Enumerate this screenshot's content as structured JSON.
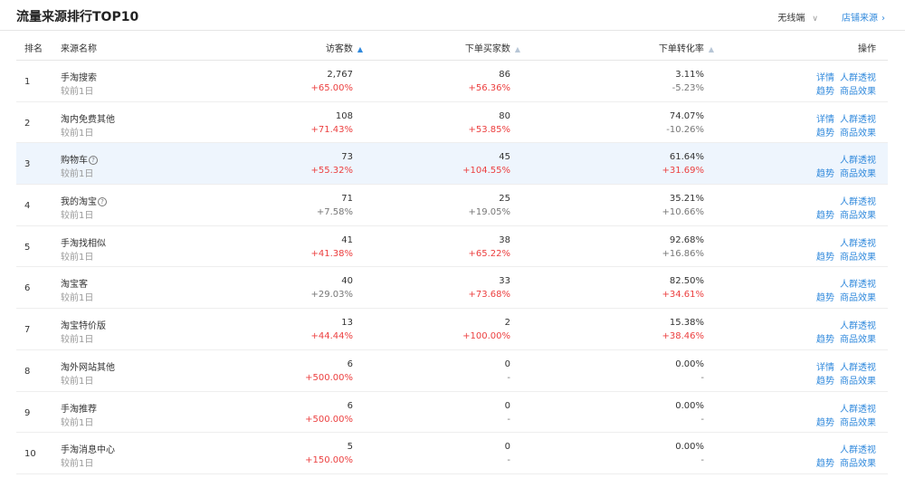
{
  "header": {
    "title": "流量来源排行TOP10",
    "device": "无线端",
    "device_chevron": "∨",
    "source_link": "店铺来源",
    "source_chevron": "›"
  },
  "columns": {
    "rank": "排名",
    "source": "来源名称",
    "visitors": "访客数",
    "buyers": "下单买家数",
    "conversion": "下单转化率",
    "actions": "操作"
  },
  "actions": {
    "detail": "详情",
    "crowd": "人群透视",
    "trend": "趋势",
    "product": "商品效果"
  },
  "rows": [
    {
      "rank": "1",
      "name": "手淘搜索",
      "help": false,
      "sub": "较前1日",
      "visitors": "2,767",
      "visitors_chg": "+65.00%",
      "visitors_up": true,
      "buyers": "86",
      "buyers_chg": "+56.36%",
      "buyers_up": true,
      "conv": "3.11%",
      "conv_chg": "-5.23%",
      "conv_up": false,
      "detail": true,
      "highlight": false
    },
    {
      "rank": "2",
      "name": "淘内免费其他",
      "help": false,
      "sub": "较前1日",
      "visitors": "108",
      "visitors_chg": "+71.43%",
      "visitors_up": true,
      "buyers": "80",
      "buyers_chg": "+53.85%",
      "buyers_up": true,
      "conv": "74.07%",
      "conv_chg": "-10.26%",
      "conv_up": false,
      "detail": true,
      "highlight": false
    },
    {
      "rank": "3",
      "name": "购物车",
      "help": true,
      "sub": "较前1日",
      "visitors": "73",
      "visitors_chg": "+55.32%",
      "visitors_up": true,
      "buyers": "45",
      "buyers_chg": "+104.55%",
      "buyers_up": true,
      "conv": "61.64%",
      "conv_chg": "+31.69%",
      "conv_up": true,
      "detail": false,
      "highlight": true
    },
    {
      "rank": "4",
      "name": "我的淘宝",
      "help": true,
      "sub": "较前1日",
      "visitors": "71",
      "visitors_chg": "+7.58%",
      "visitors_up": false,
      "buyers": "25",
      "buyers_chg": "+19.05%",
      "buyers_up": false,
      "conv": "35.21%",
      "conv_chg": "+10.66%",
      "conv_up": false,
      "detail": false,
      "highlight": false
    },
    {
      "rank": "5",
      "name": "手淘找相似",
      "help": false,
      "sub": "较前1日",
      "visitors": "41",
      "visitors_chg": "+41.38%",
      "visitors_up": true,
      "buyers": "38",
      "buyers_chg": "+65.22%",
      "buyers_up": true,
      "conv": "92.68%",
      "conv_chg": "+16.86%",
      "conv_up": false,
      "detail": false,
      "highlight": false
    },
    {
      "rank": "6",
      "name": "淘宝客",
      "help": false,
      "sub": "较前1日",
      "visitors": "40",
      "visitors_chg": "+29.03%",
      "visitors_up": false,
      "buyers": "33",
      "buyers_chg": "+73.68%",
      "buyers_up": true,
      "conv": "82.50%",
      "conv_chg": "+34.61%",
      "conv_up": true,
      "detail": false,
      "highlight": false
    },
    {
      "rank": "7",
      "name": "淘宝特价版",
      "help": false,
      "sub": "较前1日",
      "visitors": "13",
      "visitors_chg": "+44.44%",
      "visitors_up": true,
      "buyers": "2",
      "buyers_chg": "+100.00%",
      "buyers_up": true,
      "conv": "15.38%",
      "conv_chg": "+38.46%",
      "conv_up": true,
      "detail": false,
      "highlight": false
    },
    {
      "rank": "8",
      "name": "淘外网站其他",
      "help": false,
      "sub": "较前1日",
      "visitors": "6",
      "visitors_chg": "+500.00%",
      "visitors_up": true,
      "buyers": "0",
      "buyers_chg": "-",
      "buyers_up": false,
      "conv": "0.00%",
      "conv_chg": "-",
      "conv_up": false,
      "detail": true,
      "highlight": false
    },
    {
      "rank": "9",
      "name": "手淘推荐",
      "help": false,
      "sub": "较前1日",
      "visitors": "6",
      "visitors_chg": "+500.00%",
      "visitors_up": true,
      "buyers": "0",
      "buyers_chg": "-",
      "buyers_up": false,
      "conv": "0.00%",
      "conv_chg": "-",
      "conv_up": false,
      "detail": false,
      "highlight": false
    },
    {
      "rank": "10",
      "name": "手淘消息中心",
      "help": false,
      "sub": "较前1日",
      "visitors": "5",
      "visitors_chg": "+150.00%",
      "visitors_up": true,
      "buyers": "0",
      "buyers_chg": "-",
      "buyers_up": false,
      "conv": "0.00%",
      "conv_chg": "-",
      "conv_up": false,
      "detail": false,
      "highlight": false
    }
  ]
}
